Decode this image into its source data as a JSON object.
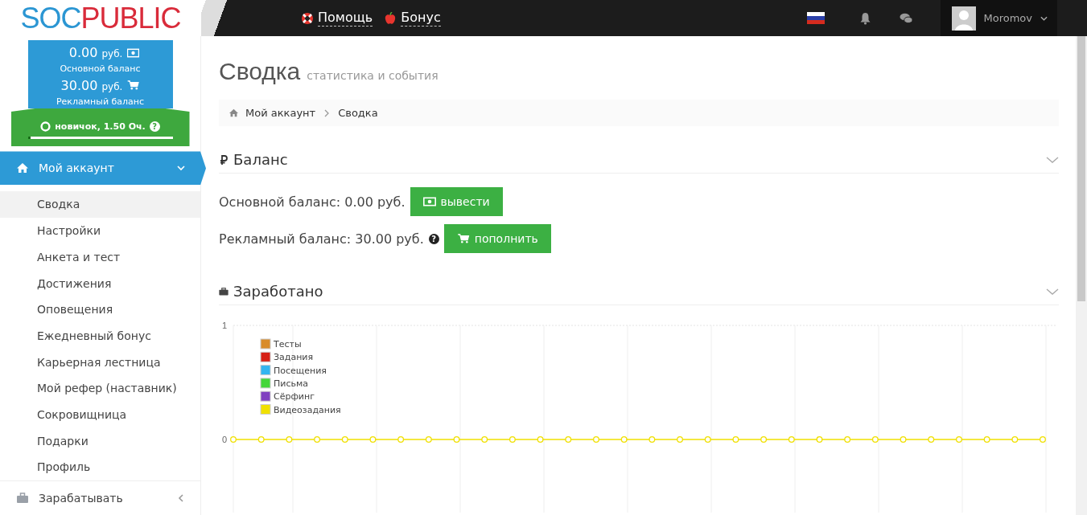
{
  "header": {
    "logo": {
      "first": "SOC",
      "second": "PUBLIC"
    },
    "links": [
      {
        "kind": "help",
        "label": "Помощь"
      },
      {
        "kind": "bonus",
        "label": "Бонус"
      }
    ],
    "user": {
      "name": "Moromov"
    }
  },
  "wallet": {
    "main_amount": "0.00",
    "main_currency": "руб.",
    "main_label": "Основной баланс",
    "ad_amount": "30.00",
    "ad_currency": "руб.",
    "ad_label": "Рекламный баланс",
    "rank": "новичок, 1.50 Оч.",
    "help_glyph": "?",
    "level": 0.02
  },
  "sidebar": {
    "menu": [
      {
        "label": "Мой аккаунт",
        "kind": "home",
        "expanded": true,
        "selected": true,
        "children": [
          {
            "label": "Сводка",
            "selected": true
          },
          {
            "label": "Настройки",
            "selected": false
          },
          {
            "label": "Анкета и тест",
            "selected": false
          },
          {
            "label": "Достижения",
            "selected": false
          },
          {
            "label": "Оповещения",
            "selected": false
          },
          {
            "label": "Ежедневный бонус",
            "selected": false
          },
          {
            "label": "Карьерная лестница",
            "selected": false
          },
          {
            "label": "Мой рефер (наставник)",
            "selected": false
          },
          {
            "label": "Сокровищница",
            "selected": false
          },
          {
            "label": "Подарки",
            "selected": false
          },
          {
            "label": "Профиль",
            "selected": false
          }
        ]
      },
      {
        "label": "Зарабатывать",
        "kind": "briefcase",
        "expanded": false,
        "selected": false
      }
    ]
  },
  "page": {
    "title": "Сводка",
    "subtitle": "статистика и события",
    "breadcrumb": [
      "Мой аккаунт",
      "Сводка"
    ]
  },
  "balance": {
    "title": "Баланс",
    "rows": [
      {
        "kind": "withdraw",
        "text": "Основной баланс: 0.00 руб.",
        "button": "вывести"
      },
      {
        "kind": "topup",
        "text": "Рекламный баланс: 30.00 руб.",
        "button": "пополнить",
        "help_glyph": "?"
      }
    ]
  },
  "earned": {
    "title": "Заработано",
    "chart_data": {
      "type": "line",
      "ylim": [
        -0.64,
        1
      ],
      "yticks": [
        0,
        1
      ],
      "grid": true,
      "legend": true,
      "series": [
        {
          "name": "Тесты",
          "color": "#d98c2a",
          "values": [
            null,
            null,
            null,
            null,
            null,
            null,
            null,
            null,
            null,
            null,
            null,
            null,
            null,
            null,
            null,
            null,
            null,
            null,
            null,
            null,
            null,
            null,
            null,
            null,
            null,
            null,
            null,
            null,
            null,
            null
          ]
        },
        {
          "name": "Задания",
          "color": "#d62015",
          "values": [
            null,
            null,
            null,
            null,
            null,
            null,
            null,
            null,
            null,
            null,
            null,
            null,
            null,
            null,
            null,
            null,
            null,
            null,
            null,
            null,
            null,
            null,
            null,
            null,
            null,
            null,
            null,
            null,
            null,
            null
          ]
        },
        {
          "name": "Посещения",
          "color": "#33b5f0",
          "values": [
            null,
            null,
            null,
            null,
            null,
            null,
            null,
            null,
            null,
            null,
            null,
            null,
            null,
            null,
            null,
            null,
            null,
            null,
            null,
            null,
            null,
            null,
            null,
            null,
            null,
            null,
            null,
            null,
            null,
            null
          ]
        },
        {
          "name": "Письма",
          "color": "#44d63a",
          "values": [
            null,
            null,
            null,
            null,
            null,
            null,
            null,
            null,
            null,
            null,
            null,
            null,
            null,
            null,
            null,
            null,
            null,
            null,
            null,
            null,
            null,
            null,
            null,
            null,
            null,
            null,
            null,
            null,
            null,
            null
          ]
        },
        {
          "name": "Сёрфинг",
          "color": "#8040c0",
          "values": [
            null,
            null,
            null,
            null,
            null,
            null,
            null,
            null,
            null,
            null,
            null,
            null,
            null,
            null,
            null,
            null,
            null,
            null,
            null,
            null,
            null,
            null,
            null,
            null,
            null,
            null,
            null,
            null,
            null,
            null
          ]
        },
        {
          "name": "Видеозадания",
          "color": "#f0e000",
          "marker": "circle",
          "values": [
            0,
            0,
            0,
            0,
            0,
            0,
            0,
            0,
            0,
            0,
            0,
            0,
            0,
            0,
            0,
            0,
            0,
            0,
            0,
            0,
            0,
            0,
            0,
            0,
            0,
            0,
            0,
            0,
            0,
            0
          ]
        }
      ]
    }
  }
}
